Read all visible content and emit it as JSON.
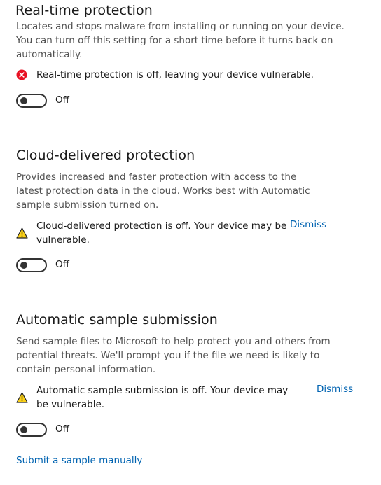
{
  "realtime": {
    "title": "Real-time protection",
    "description": "Locates and stops malware from installing or running on your device. You can turn off this setting for a short time before it turns back on automatically.",
    "status_icon": "error-icon",
    "status_text": "Real-time protection is off, leaving your device vulnerable.",
    "toggle_state": "Off"
  },
  "cloud": {
    "title": "Cloud-delivered protection",
    "description": "Provides increased and faster protection with access to the latest protection data in the cloud. Works best with Automatic sample submission turned on.",
    "status_icon": "warning-icon",
    "status_text": "Cloud-delivered protection is off. Your device may be vulnerable.",
    "dismiss_label": "Dismiss",
    "toggle_state": "Off"
  },
  "sample": {
    "title": "Automatic sample submission",
    "description": "Send sample files to Microsoft to help protect you and others from potential threats. We'll prompt you if the file we need is likely to contain personal information.",
    "status_icon": "warning-icon",
    "status_text": "Automatic sample submission is off. Your device may be vulnerable.",
    "dismiss_label": "Dismiss",
    "toggle_state": "Off",
    "manual_link": "Submit a sample manually"
  },
  "colors": {
    "error": "#e81123",
    "warning": "#fcd116",
    "link": "#0063b1"
  }
}
